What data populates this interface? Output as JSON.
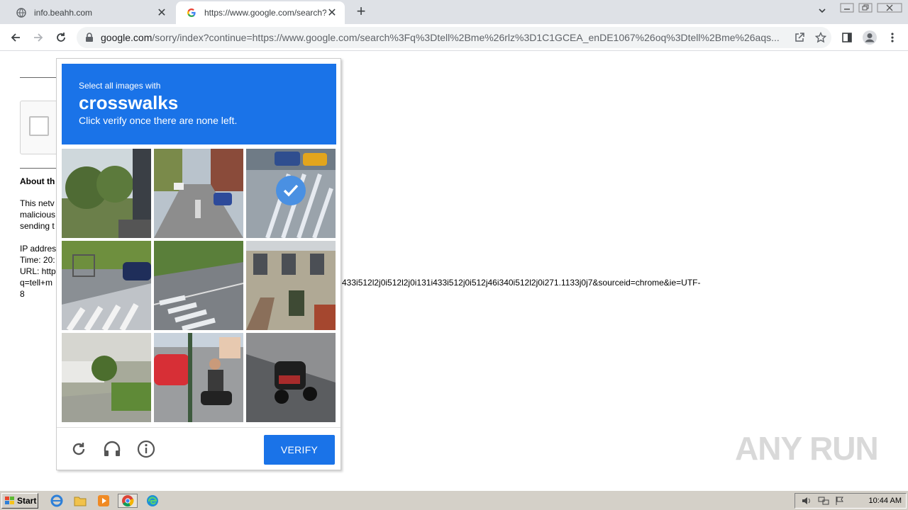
{
  "tabs": [
    {
      "title": "info.beahh.com",
      "icon": "globe-icon"
    },
    {
      "title": "https://www.google.com/search?q=",
      "icon": "google-icon"
    }
  ],
  "address_bar": {
    "host": "google.com",
    "path": "/sorry/index?continue=https://www.google.com/search%3Fq%3Dtell%2Bme%26rlz%3D1C1GCEA_enDE1067%26oq%3Dtell%2Bme%26aqs..."
  },
  "page": {
    "heading": "About th",
    "lines": [
      "This netv",
      "malicious",
      "sending t"
    ],
    "ip_label": "IP addres",
    "time_label": "Time: 20:",
    "url_label": "URL: http",
    "url_cont": "q=tell+m",
    "url_tail": "433i512l2j0i512l2j0i131i433i512j0i512j46i340i512l2j0i271.1133j0j7&sourceid=chrome&ie=UTF-",
    "url_end": "8"
  },
  "captcha": {
    "prompt_small": "Select all images with",
    "prompt_target": "crosswalks",
    "prompt_sub": "Click verify once there are none left.",
    "verify_label": "VERIFY",
    "selected_tiles": [
      2
    ]
  },
  "watermark": "ANY RUN",
  "taskbar": {
    "start_label": "Start",
    "clock": "10:44 AM"
  },
  "colors": {
    "accent": "#1a73e8"
  }
}
